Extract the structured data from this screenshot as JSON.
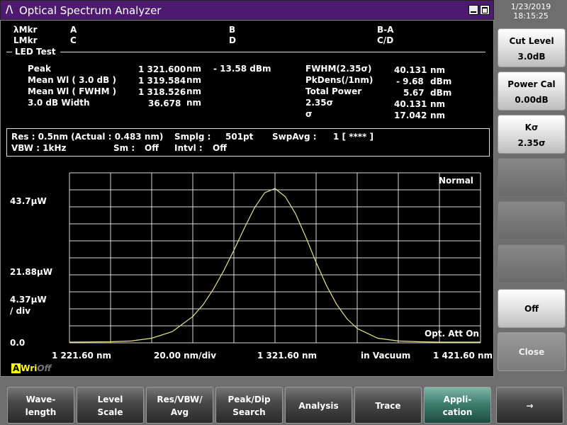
{
  "title_bar": {
    "logo": "/\\",
    "title": "Optical Spectrum Analyzer"
  },
  "datetime": {
    "date": "1/23/2019",
    "time": "18:15:25"
  },
  "markers": {
    "lambda_label": "λMkr",
    "level_label": "LMkr",
    "a": "A",
    "b": "B",
    "c": "C",
    "d": "D",
    "ba": "B-A",
    "cd": "C/D"
  },
  "section_title": "LED Test",
  "results_left": [
    {
      "label": "Peak",
      "value": "1 321.600",
      "unit": "nm",
      "extra": "-  13.58  dBm"
    },
    {
      "label": "Mean Wl  (  3.0   dB  )",
      "value": "1 319.584",
      "unit": "nm",
      "extra": ""
    },
    {
      "label": "Mean Wl  ( FWHM )",
      "value": "1 318.526",
      "unit": "nm",
      "extra": ""
    },
    {
      "label": "3.0      dB Width",
      "value": "36.678",
      "unit": "nm",
      "extra": ""
    }
  ],
  "results_right": [
    {
      "label": "FWHM(2.35σ)",
      "value": "40.131",
      "unit": "nm"
    },
    {
      "label": "PkDens(/1nm)",
      "value": "-  9.68",
      "unit": "dBm"
    },
    {
      "label": "Total Power",
      "value": "5.67",
      "unit": "dBm"
    },
    {
      "label": "2.35σ",
      "value": "40.131",
      "unit": "nm"
    },
    {
      "label": "σ",
      "value": "17.042",
      "unit": "nm"
    }
  ],
  "settings": {
    "res": "Res :  0.5nm  (Actual :  0.483 nm)",
    "smplg_label": "Smplg :",
    "smplg": "501pt",
    "swpavg_label": "SwpAvg :",
    "swpavg": "1 [     ****  ]",
    "vbw": "VBW :      1kHz",
    "sm_label": "Sm :",
    "sm": "Off",
    "intvl_label": "Intvl :",
    "intvl": "Off"
  },
  "graph": {
    "mode": "Normal",
    "opt_att": "Opt. Att On",
    "y_top": "43.7μW",
    "y_mid": "21.88μW",
    "y_div_1": "4.37μW",
    "y_div_2": "/ div",
    "y_zero": "0.0",
    "x_start": "1 221.60 nm",
    "x_div": "20.00 nm/div",
    "x_center": "1 321.60 nm",
    "x_medium": "in Vacuum",
    "x_stop": "1 421.60 nm",
    "trace_color": "#e8e28a"
  },
  "chart_data": {
    "type": "line",
    "x_unit": "nm",
    "y_unit": "μW",
    "xlim": [
      1221.6,
      1421.6
    ],
    "ylim": [
      0,
      43.7
    ],
    "series": [
      {
        "x": [
          1221.6,
          1241.6,
          1251.6,
          1261.6,
          1271.6,
          1281.6,
          1286.6,
          1291.6,
          1296.6,
          1301.6,
          1306.6,
          1311.6,
          1316.6,
          1321.6,
          1326.6,
          1331.6,
          1336.6,
          1341.6,
          1346.6,
          1351.6,
          1356.6,
          1361.6,
          1371.6,
          1381.6,
          1391.6,
          1401.6,
          1421.6
        ],
        "y": [
          0.0,
          0.1,
          0.3,
          1.0,
          2.7,
          6.6,
          9.6,
          13.6,
          18.3,
          23.6,
          29.2,
          34.5,
          38.4,
          39.5,
          37.4,
          33.0,
          27.0,
          20.5,
          14.6,
          9.7,
          6.0,
          3.5,
          1.0,
          0.3,
          0.1,
          0.0,
          0.0
        ]
      }
    ]
  },
  "status": {
    "a": "A",
    "wri": "Wri",
    "off": "Off"
  },
  "side_buttons": [
    {
      "l1": "Cut Level",
      "l2": "3.0dB"
    },
    {
      "l1": "Power Cal",
      "l2": "0.00dB"
    },
    {
      "l1": "Kσ",
      "l2": "2.35σ"
    },
    {
      "l1": "",
      "l2": ""
    },
    {
      "l1": "",
      "l2": ""
    },
    {
      "l1": "Off",
      "l2": ""
    },
    {
      "l1": "Close",
      "l2": ""
    }
  ],
  "bottom_buttons": [
    {
      "l1": "Wave-",
      "l2": "length"
    },
    {
      "l1": "Level",
      "l2": "Scale"
    },
    {
      "l1": "Res/VBW/",
      "l2": "Avg"
    },
    {
      "l1": "Peak/Dip",
      "l2": "Search"
    },
    {
      "l1": "Analysis",
      "l2": ""
    },
    {
      "l1": "Trace",
      "l2": ""
    },
    {
      "l1": "Appli-",
      "l2": "cation"
    },
    {
      "l1": "→",
      "l2": ""
    }
  ]
}
